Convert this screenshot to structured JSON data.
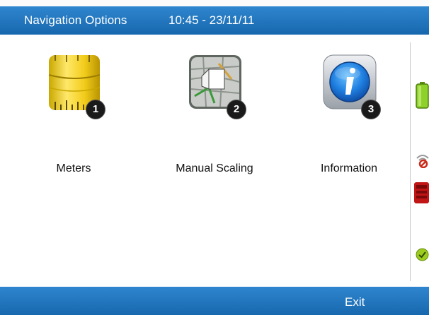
{
  "header": {
    "title": "Navigation Options",
    "clock": "10:45 - 23/11/11"
  },
  "options": [
    {
      "label": "Meters",
      "number": "1",
      "icon": "tape-measure-icon"
    },
    {
      "label": "Manual Scaling",
      "number": "2",
      "icon": "map-scale-icon"
    },
    {
      "label": "Information",
      "number": "3",
      "icon": "info-icon"
    }
  ],
  "status_icons": [
    "battery-icon",
    "no-signal-icon",
    "red-device-icon",
    "ok-check-icon"
  ],
  "footer": {
    "exit_label": "Exit"
  },
  "colors": {
    "bar_top": "#2f86cf",
    "bar_bottom": "#1767ad"
  }
}
